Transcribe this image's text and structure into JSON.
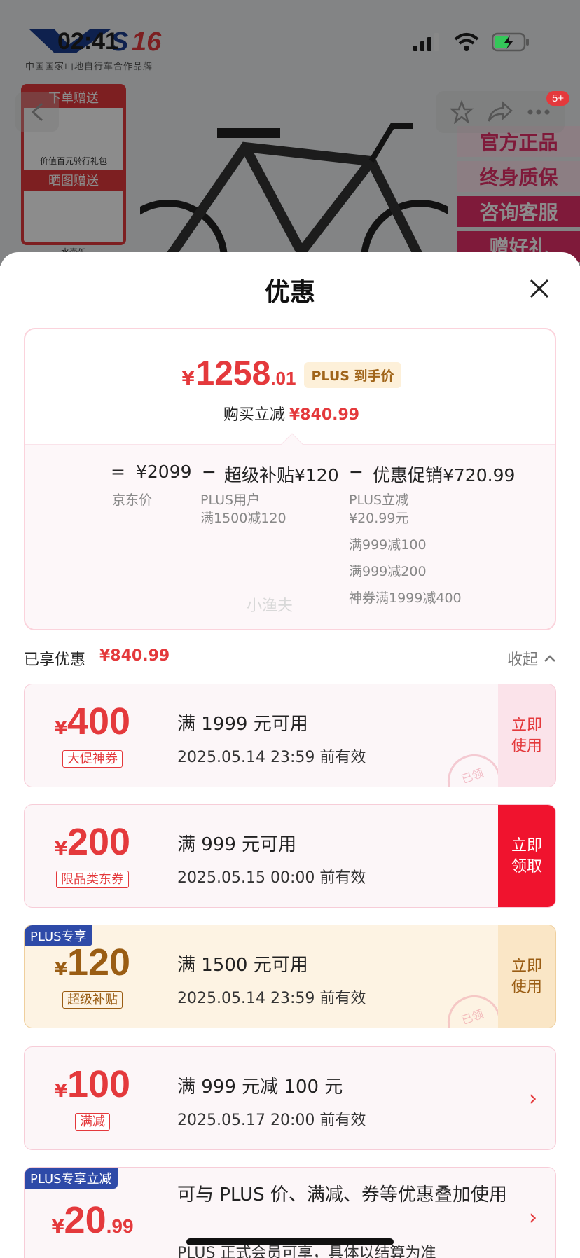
{
  "status_bar": {
    "time": "02:41"
  },
  "background": {
    "brand_sub": "中国国家山地自行车合作品牌",
    "gift": {
      "order_gift_label": "下单赠送",
      "order_gift_desc": "价值百元骑行礼包",
      "photo_gift_label": "晒图赠送",
      "photo_gift_desc": "水壶架"
    },
    "ads": [
      "官方正品",
      "终身质保",
      "咨询客服",
      "赠好礼"
    ],
    "message_badge": "5+"
  },
  "sheet": {
    "title": "优惠",
    "price": {
      "currency": "¥",
      "integer": "1258",
      "decimal": ".01",
      "plus_tag": "PLUS 到手价",
      "saved_label": "购买立减",
      "saved_amount": "¥840.99"
    },
    "formula": {
      "eq": "=",
      "jd_price": "¥2099",
      "jd_price_label": "京东价",
      "minus1": "−",
      "subsidy": "超级补贴¥120",
      "subsidy_note1": "PLUS用户",
      "subsidy_note2": "满1500减120",
      "minus2": "−",
      "promo": "优惠促销¥720.99",
      "promo_notes": [
        "PLUS立减",
        "¥20.99元",
        "满999减100",
        "满999减200",
        "神券满1999减400"
      ]
    },
    "watermark": "小渔夫",
    "enjoyed": {
      "label": "已享优惠",
      "amount": "¥840.99",
      "collapse": "收起"
    },
    "coupons": [
      {
        "currency": "¥",
        "amount": "400",
        "tag": "大促神券",
        "title": "满 1999 元可用",
        "date": "2025.05.14 23:59 前有效",
        "action": "立即使用",
        "stamp": "已领"
      },
      {
        "currency": "¥",
        "amount": "200",
        "tag": "限品类东券",
        "title": "满 999 元可用",
        "date": "2025.05.15 00:00 前有效",
        "action": "立即领取"
      },
      {
        "flag": "PLUS专享",
        "currency": "¥",
        "amount": "120",
        "tag": "超级补贴",
        "title": "满 1500 元可用",
        "date": "2025.05.14 23:59 前有效",
        "action": "立即使用",
        "stamp": "已领"
      },
      {
        "currency": "¥",
        "amount": "100",
        "tag": "满减",
        "title": "满 999 元减 100 元",
        "date": "2025.05.17 20:00 前有效"
      },
      {
        "flag": "PLUS专享立减",
        "currency": "¥",
        "amount": "20",
        "decimal": ".99",
        "title": "可与 PLUS 价、满减、券等优惠叠加使用",
        "date": "PLUS 正式会员可享，具体以结算为准"
      }
    ]
  },
  "colors": {
    "accent": "#e4393c",
    "gold": "#9a5d14",
    "plus_blue": "#2e4aa8"
  }
}
